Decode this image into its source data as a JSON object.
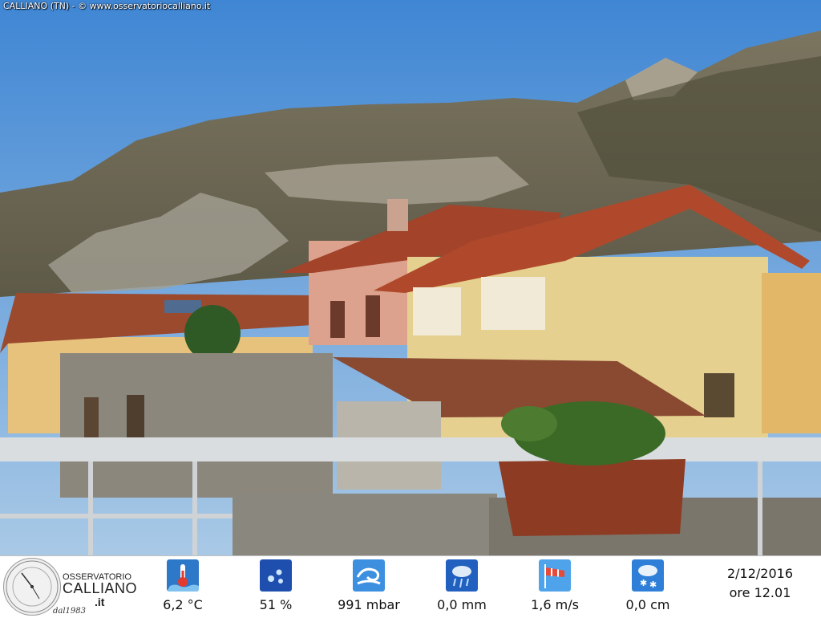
{
  "caption": "CALLIANO (TN) - © www.osservatoriocalliano.it",
  "logo": {
    "line1": "OSSERVATORIO",
    "line2": "CALLIANO",
    "line3": ".it",
    "since": "dal1983"
  },
  "readings": [
    {
      "icon": "thermometer-icon",
      "value": "6,2 °C"
    },
    {
      "icon": "humidity-icon",
      "value": "51 %"
    },
    {
      "icon": "pressure-icon",
      "value": "991 mbar"
    },
    {
      "icon": "rain-icon",
      "value": "0,0 mm"
    },
    {
      "icon": "wind-icon",
      "value": "1,6 m/s"
    },
    {
      "icon": "snow-icon",
      "value": "0,0 cm"
    }
  ],
  "date": "2/12/2016",
  "time": "ore 12.01",
  "colors": {
    "sky": "#5a9ad8",
    "mountain": "#6d6a5a",
    "roof": "#a24a2c",
    "wall_pink": "#e0a893",
    "wall_yellow": "#e8d79a",
    "icon_blue": "#2f6fc0"
  }
}
